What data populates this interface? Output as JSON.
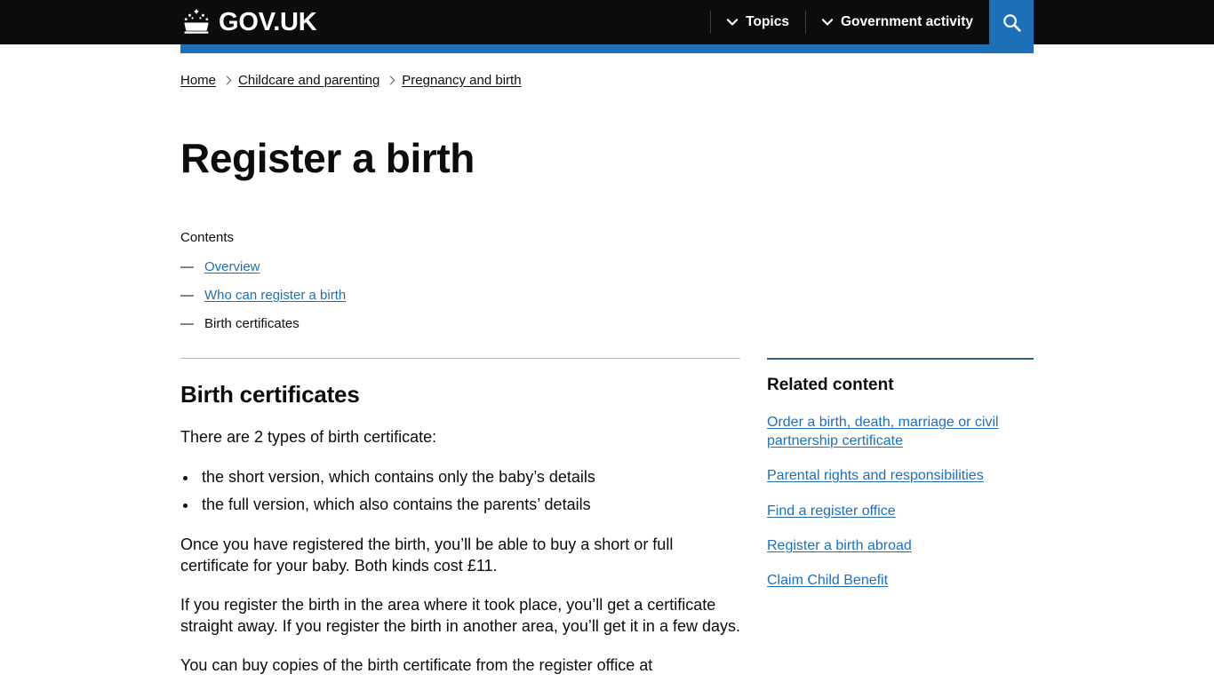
{
  "header": {
    "logo_text": "GOV.UK",
    "crown_icon": "crown-icon",
    "nav": [
      {
        "label": "Topics",
        "icon": "chevron-down-icon"
      },
      {
        "label": "Government activity",
        "icon": "chevron-down-icon"
      }
    ],
    "search_icon": "search-icon",
    "accent_color": "#1d70b8",
    "background_color": "#0b0c0c"
  },
  "breadcrumbs": [
    {
      "label": "Home"
    },
    {
      "label": "Childcare and parenting"
    },
    {
      "label": "Pregnancy and birth"
    }
  ],
  "page": {
    "title": "Register a birth"
  },
  "contents": {
    "heading": "Contents",
    "marker": "—",
    "items": [
      {
        "label": "Overview",
        "current": false
      },
      {
        "label": "Who can register a birth",
        "current": false
      },
      {
        "label": "Birth certificates",
        "current": true
      }
    ]
  },
  "main": {
    "heading": "Birth certificates",
    "intro": "There are 2 types of birth certificate:",
    "bullets": [
      "the short version, which contains only the baby’s details",
      "the full version, which also contains the parents’ details"
    ],
    "paragraph_1": "Once you have registered the birth, you’ll be able to buy a short or full certificate for your baby. Both kinds cost £11.",
    "paragraph_2": "If you register the birth in the area where it took place, you’ll get a certificate straight away. If you register the birth in another area, you’ll get it in a few days.",
    "paragraph_3_clipped": "You can buy copies of the birth certificate from the register office at"
  },
  "sidebar": {
    "heading": "Related content",
    "links": [
      {
        "label": "Order a birth, death, marriage or civil partnership certificate"
      },
      {
        "label": "Parental rights and responsibilities"
      },
      {
        "label": "Find a register office"
      },
      {
        "label": "Register a birth abroad"
      },
      {
        "label": "Claim Child Benefit"
      }
    ]
  },
  "colors": {
    "link": "#1d70b8",
    "text": "#0b0c0c",
    "rule": "#b1b4b6",
    "sidebar_rule": "#2e5f81"
  }
}
